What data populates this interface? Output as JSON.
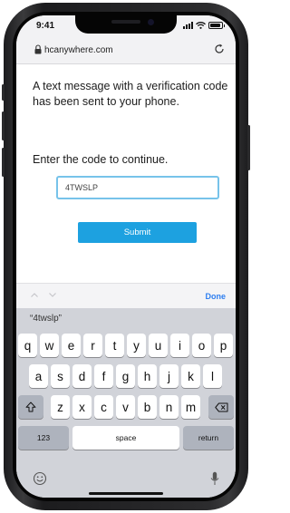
{
  "status_bar": {
    "time": "9:41"
  },
  "browser": {
    "url": "hcanywhere.com"
  },
  "page": {
    "message": "A text message with a verification code has been sent to your phone.",
    "prompt": "Enter the code to continue.",
    "code_value": "4TWSLP",
    "submit_label": "Submit"
  },
  "keyboard": {
    "done_label": "Done",
    "suggestion": "“4twslp”",
    "row1": [
      "q",
      "w",
      "e",
      "r",
      "t",
      "y",
      "u",
      "i",
      "o",
      "p"
    ],
    "row2": [
      "a",
      "s",
      "d",
      "f",
      "g",
      "h",
      "j",
      "k",
      "l"
    ],
    "row3": [
      "z",
      "x",
      "c",
      "v",
      "b",
      "n",
      "m"
    ],
    "numbers_label": "123",
    "space_label": "space",
    "return_label": "return"
  },
  "colors": {
    "accent": "#1da1e0",
    "input_border": "#77c3ea",
    "done": "#2f7ff0"
  }
}
